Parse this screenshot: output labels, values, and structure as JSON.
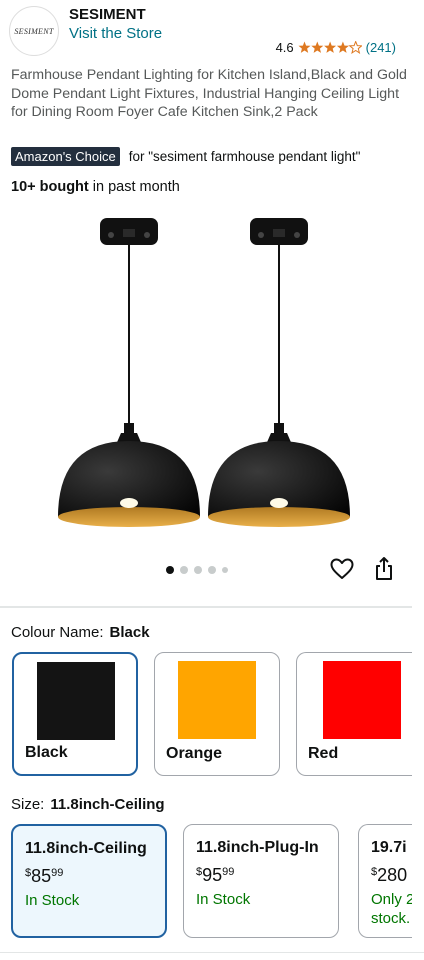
{
  "store": {
    "logo_text": "SESIMENT",
    "brand": "SESIMENT",
    "visit_label": "Visit the Store",
    "rating_value": "4.6",
    "rating_stars": 4.5,
    "rating_count": "(241)"
  },
  "product": {
    "title": "Farmhouse Pendant Lighting for Kitchen Island,Black and Gold Dome Pendant Light Fixtures, Industrial Hanging Ceiling Light for Dining Room Foyer Cafe Kitchen Sink,2 Pack",
    "badge": "Amazon's Choice",
    "badge_for": "for \"sesiment farmhouse pendant light\"",
    "bought_bold": "10+ bought",
    "bought_rest": " in past month"
  },
  "gallery": {
    "image_count": 5,
    "active_index": 0
  },
  "colour": {
    "label": "Colour Name:",
    "selected": "Black",
    "options": [
      {
        "name": "Black",
        "color": "#141414"
      },
      {
        "name": "Orange",
        "color": "#ffa500"
      },
      {
        "name": "Red",
        "color": "#ff0000"
      }
    ]
  },
  "size": {
    "label": "Size:",
    "selected": "11.8inch-Ceiling",
    "options": [
      {
        "name": "11.8inch-Ceiling",
        "price_symbol": "$",
        "price_whole": "85",
        "price_fraction": "99",
        "stock": "In Stock"
      },
      {
        "name": "11.8inch-Plug-In",
        "price_symbol": "$",
        "price_whole": "95",
        "price_fraction": "99",
        "stock": "In Stock"
      },
      {
        "name": "19.7i",
        "price_symbol": "$",
        "price_whole": "280",
        "price_fraction": "",
        "stock": "Only 2 stock."
      }
    ]
  },
  "colors": {
    "link": "#007185",
    "star": "#de7921",
    "in_stock": "#007600",
    "selected_border": "#2162a1",
    "badge_bg": "#232f3e"
  }
}
